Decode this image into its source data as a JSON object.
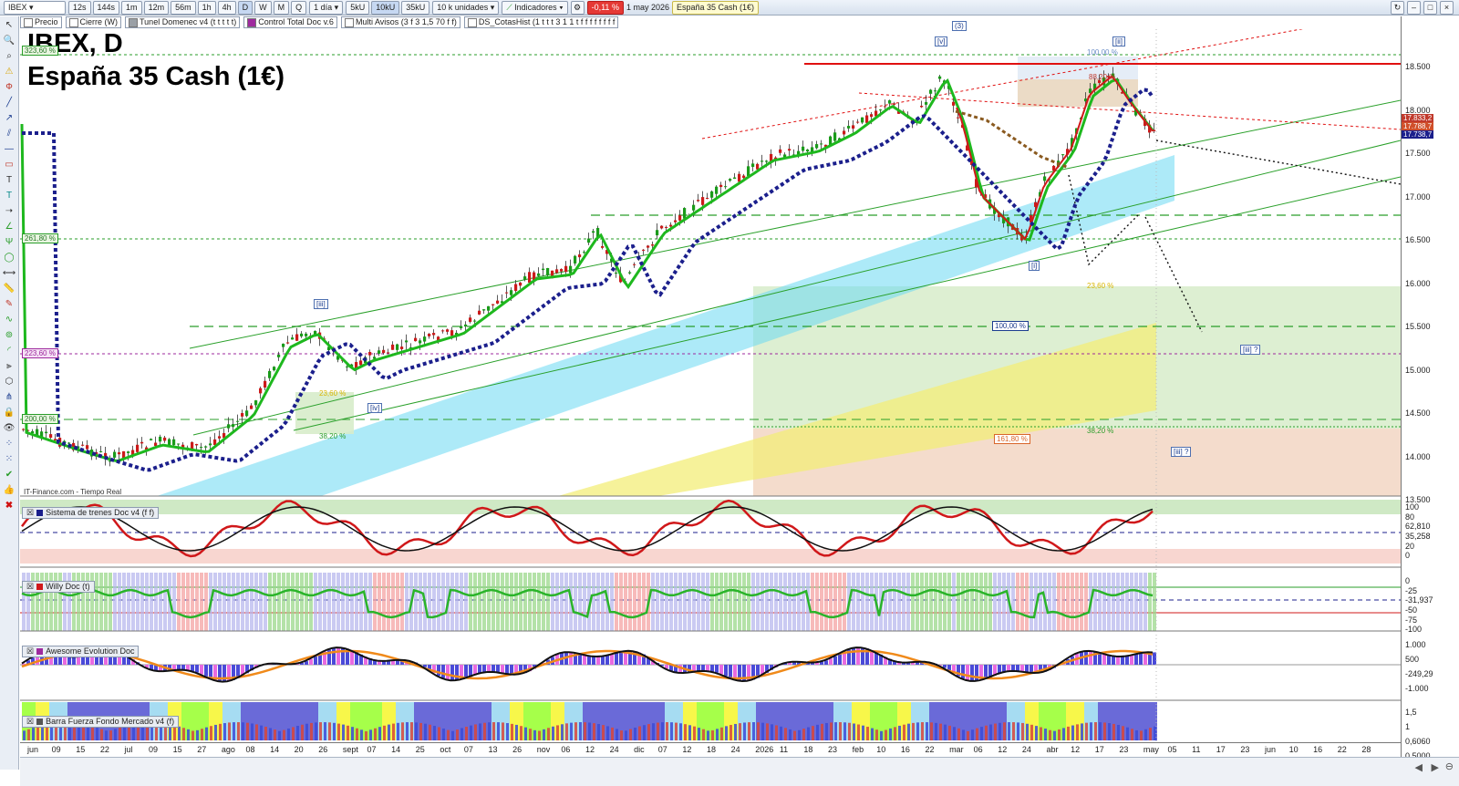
{
  "toolbar": {
    "symbol": "IBEX",
    "intervals": [
      "12s",
      "144s",
      "1m",
      "12m",
      "56m",
      "1h",
      "4h",
      "D",
      "W",
      "M",
      "Q"
    ],
    "active_interval": "D",
    "period": "1 día",
    "volumes": [
      "5kU",
      "10kU",
      "35kU"
    ],
    "active_volume": "10kU",
    "units": "10 k unidades",
    "indicators": "Indicadores",
    "change": "-0,11 %",
    "date": "1 may 2026",
    "instrument": "España 35 Cash (1€)"
  },
  "legend": [
    {
      "label": "Precio",
      "swatch": "#ffffff"
    },
    {
      "label": "Cierre (W)",
      "swatch": "#ffffff"
    },
    {
      "label": "Tunel Domenec v4 (t t t t t)",
      "swatch": "#9aa0a6"
    },
    {
      "label": "Control Total Doc v.6",
      "swatch": "#9e2a9e"
    },
    {
      "label": "Multi Avisos (3 f 3 1,5 70 f f)",
      "swatch": "#ffffff"
    },
    {
      "label": "DS_CotasHist (1 t t t 3 1 1 t f f f f f f f f",
      "swatch": "#ffffff"
    }
  ],
  "title": {
    "line1": "IBEX, D",
    "line2": "España 35 Cash (1€)"
  },
  "source": "IT-Finance.com - Tiempo Real",
  "colors": {
    "up": "#1a9b1a",
    "down": "#cc1a1a",
    "ema_fast": "#1eb81e",
    "trend_dots": "#1b1f8c",
    "resistance": "#e01010",
    "cyan_band": "#58d8f0",
    "yellow_band": "#f2ef7a",
    "green_zone": "#cfe8c2",
    "red_zone": "#f9d9cc"
  },
  "price_axis": {
    "ticks": [
      "18.500",
      "18.000",
      "17.500",
      "17.000",
      "16.500",
      "16.000",
      "15.500",
      "15.000",
      "14.500",
      "14.000",
      "13.500"
    ],
    "badges": [
      {
        "text": "17.833,2",
        "color": "#c0392b"
      },
      {
        "text": "17.788,7",
        "color": "#d04f2a"
      },
      {
        "text": "17.738,7",
        "color": "#1b1f8c"
      }
    ]
  },
  "fib_labels": {
    "left": [
      "323,60 %",
      "261,80 %",
      "223,60 %",
      "200,00 %"
    ],
    "center": [
      "100,00 %",
      "88,20 %",
      "23,60 %",
      "100,00 %",
      "38,20 %",
      "161,80 %",
      "23,60 %",
      "38,20 %"
    ]
  },
  "wave_labels": [
    "(3)",
    "[v]",
    "[ii]",
    "[iii]",
    "[iv]",
    "[i]",
    "[iii] ?",
    "[iii] ?"
  ],
  "panels": [
    {
      "title": "Sistema de trenes Doc v4 (f f)",
      "ticks": [
        "100",
        "80",
        "62,810",
        "35,258",
        "20",
        "0"
      ]
    },
    {
      "title": "Willy Doc (t)",
      "ticks": [
        "0",
        "-25",
        "-31,937",
        "-50",
        "-75",
        "-100"
      ]
    },
    {
      "title": "Awesome Evolution Doc",
      "ticks": [
        "1.000",
        "500",
        "-249,29",
        "-1.000"
      ]
    },
    {
      "title": "Barra Fuerza Fondo Mercado v4 (f)",
      "ticks": [
        "1,5",
        "1",
        "0,6060",
        "0,5000"
      ]
    }
  ],
  "date_axis": [
    "jun",
    "09",
    "15",
    "22",
    "jul",
    "09",
    "15",
    "27",
    "ago",
    "08",
    "14",
    "20",
    "26",
    "sept",
    "07",
    "14",
    "25",
    "oct",
    "07",
    "13",
    "26",
    "nov",
    "06",
    "12",
    "24",
    "dic",
    "07",
    "12",
    "18",
    "24",
    "2026",
    "11",
    "18",
    "23",
    "feb",
    "10",
    "16",
    "22",
    "mar",
    "06",
    "12",
    "24",
    "abr",
    "12",
    "17",
    "23",
    "may",
    "05",
    "11",
    "17",
    "23",
    "jun",
    "10",
    "16",
    "22",
    "28"
  ]
}
